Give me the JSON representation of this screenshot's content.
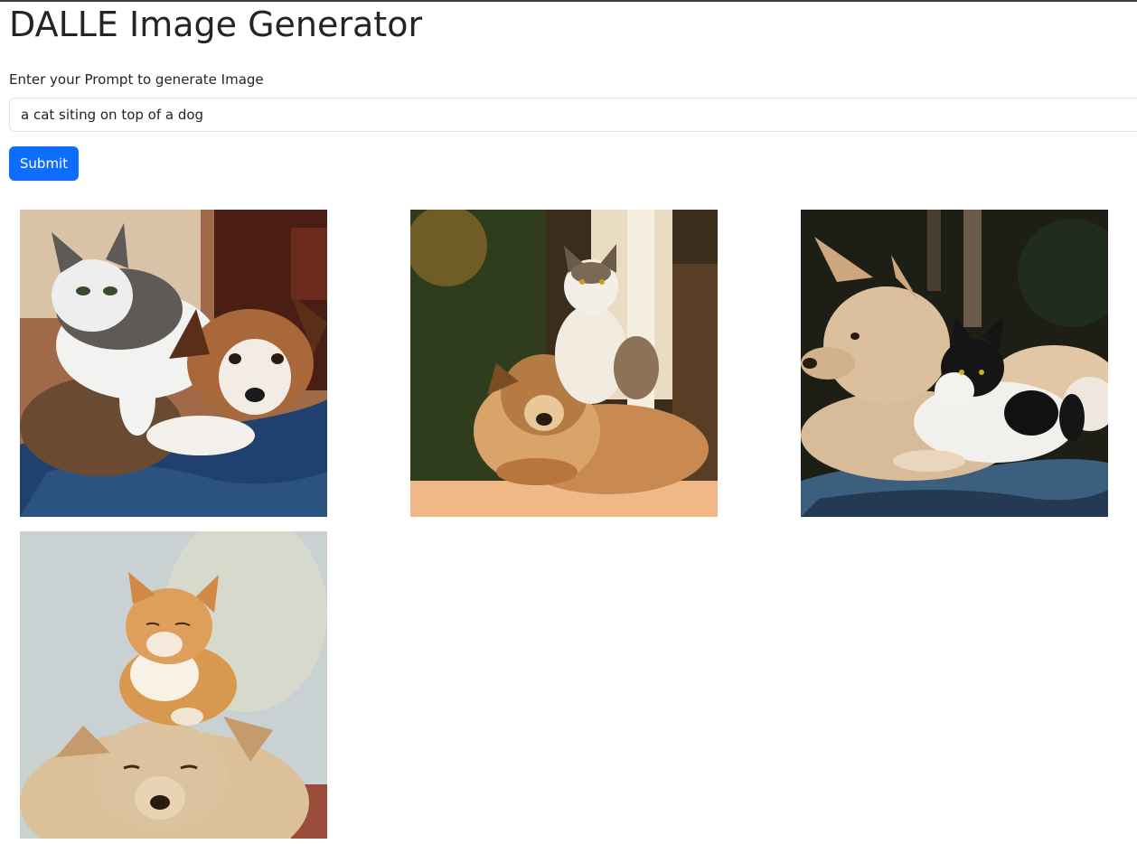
{
  "header": {
    "title": "DALLE Image Generator"
  },
  "form": {
    "prompt_label": "Enter your Prompt to generate Image",
    "prompt_value": "a cat siting on top of a dog",
    "submit_label": "Submit"
  },
  "results": {
    "images": [
      {
        "description": "generated-image",
        "palette": [
          "#6b4a35",
          "#1f3a63",
          "#ffffff",
          "#b0703a"
        ]
      },
      {
        "description": "generated-image",
        "palette": [
          "#2e3a1a",
          "#d9b26a",
          "#f2c08d",
          "#c98a47"
        ]
      },
      {
        "description": "generated-image",
        "palette": [
          "#1b1f14",
          "#d6b99a",
          "#3f5f7a",
          "#141414"
        ]
      },
      {
        "description": "generated-image",
        "palette": [
          "#c7d0d4",
          "#d9a25e",
          "#e2c9a0",
          "#ffffff"
        ]
      }
    ]
  }
}
